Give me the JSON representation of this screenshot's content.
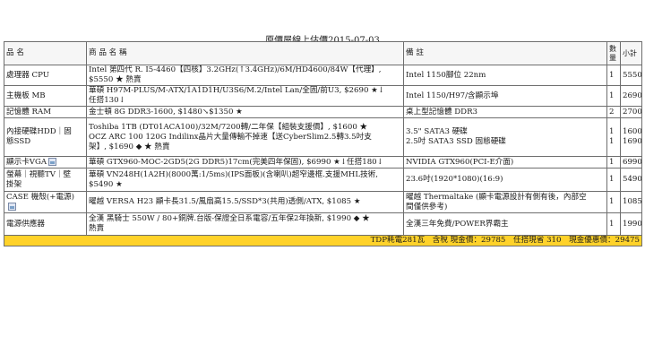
{
  "title": "原價屋線上估價2015-07-03",
  "headers": {
    "category": "品 名",
    "product": "商 品 名 稱",
    "note": "備 註",
    "qty": "數量",
    "subtotal": "小計"
  },
  "rows": [
    {
      "category": "處理器 CPU",
      "product_lines": [
        "Intel 第四代 R. I5-4460【四核】3.2GHz(↑3.4GHz)/6M/HD4600/84W【代理】,",
        "$5550 ★ 熱賣"
      ],
      "note_lines": [
        "Intel 1150腳位 22nm"
      ],
      "qty_lines": [
        "1"
      ],
      "subtotal_lines": [
        "5550"
      ]
    },
    {
      "category": "主機板 MB",
      "product_lines": [
        "華碩 H97M-PLUS/M-ATX/1A1D1H/U3S6/M.2/Intel Lan/全固/前U3, $2690 ★↓",
        "任搭130↓"
      ],
      "note_lines": [
        "Intel 1150/H97/含顯示埠"
      ],
      "qty_lines": [
        "1"
      ],
      "subtotal_lines": [
        "2690"
      ]
    },
    {
      "category": "記憶體 RAM",
      "product_lines": [
        "金士頓 8G DDR3-1600, $1480↘$1350 ★"
      ],
      "note_lines": [
        "桌上型記憶體 DDR3"
      ],
      "qty_lines": [
        "2"
      ],
      "subtotal_lines": [
        "2700"
      ]
    },
    {
      "category_lines": [
        "內接硬碟HDD｜固",
        "態SSD"
      ],
      "product_lines": [
        "Toshiba 1TB (DT01ACA100)/32M/7200轉/二年保【組裝支援價】, $1600 ★",
        "OCZ ARC 100 120G Indilinx晶片大量傳輸不掉速【送CyberSlim2.5轉3.5吋支",
        "架】, $1690 ◆ ★ 熱賣"
      ],
      "note_lines": [
        "3.5\" SATA3 硬碟",
        "2.5吋 SATA3 SSD 固態硬碟"
      ],
      "qty_lines": [
        "1",
        "1"
      ],
      "subtotal_lines": [
        "1600",
        "1690"
      ]
    },
    {
      "category": "顯示卡VGA",
      "product_lines": [
        "華碩 GTX960-MOC-2GD5(2G DDR5)17cm(完美四年保固), $6990 ★↓任搭180↓"
      ],
      "note_lines": [
        "NVIDIA GTX960(PCI-E介面)"
      ],
      "qty_lines": [
        "1"
      ],
      "subtotal_lines": [
        "6990"
      ]
    },
    {
      "category_lines": [
        "螢幕｜視聽TV｜壁",
        "掛架"
      ],
      "product_lines": [
        "華碩 VN248H(1A2H)(8000萬:1/5ms)(IPS面板)(含喇叭)超窄邊框.支援MHL技術,",
        "$5490 ★"
      ],
      "note_lines": [
        "23.6吋(1920*1080)(16:9)"
      ],
      "qty_lines": [
        "1"
      ],
      "subtotal_lines": [
        "5490"
      ]
    },
    {
      "category": "CASE 機殼(+電源)",
      "product_lines": [
        "曜越 VERSA H23 顯卡長31.5/風扇高15.5/SSD*3(共用)透側/ATX, $1085 ★"
      ],
      "note_lines": [
        "曜越 Thermaltake (顯卡電源設計有側有後，內部空",
        "間僅供參考)"
      ],
      "qty_lines": [
        "1"
      ],
      "subtotal_lines": [
        "1085"
      ]
    },
    {
      "category": "電源供應器",
      "product_lines": [
        "全漢 黑騎士 550W / 80+銅牌.台版-保證全日系電容/五年保2年換新, $1990 ◆ ★",
        "熱賣"
      ],
      "note_lines": [
        "全漢三年免費/POWER界霸主"
      ],
      "qty_lines": [
        "1"
      ],
      "subtotal_lines": [
        "1990"
      ]
    }
  ],
  "total": "TDP耗電281瓦　含稅 現金價：29785　任搭現省 310　現金優惠價：29475",
  "colors": {
    "total_bg": "#ffd22a",
    "border": "#6e6e6e"
  },
  "icons": {
    "vga_image": "broken-image-icon",
    "case_image": "broken-image-icon"
  }
}
